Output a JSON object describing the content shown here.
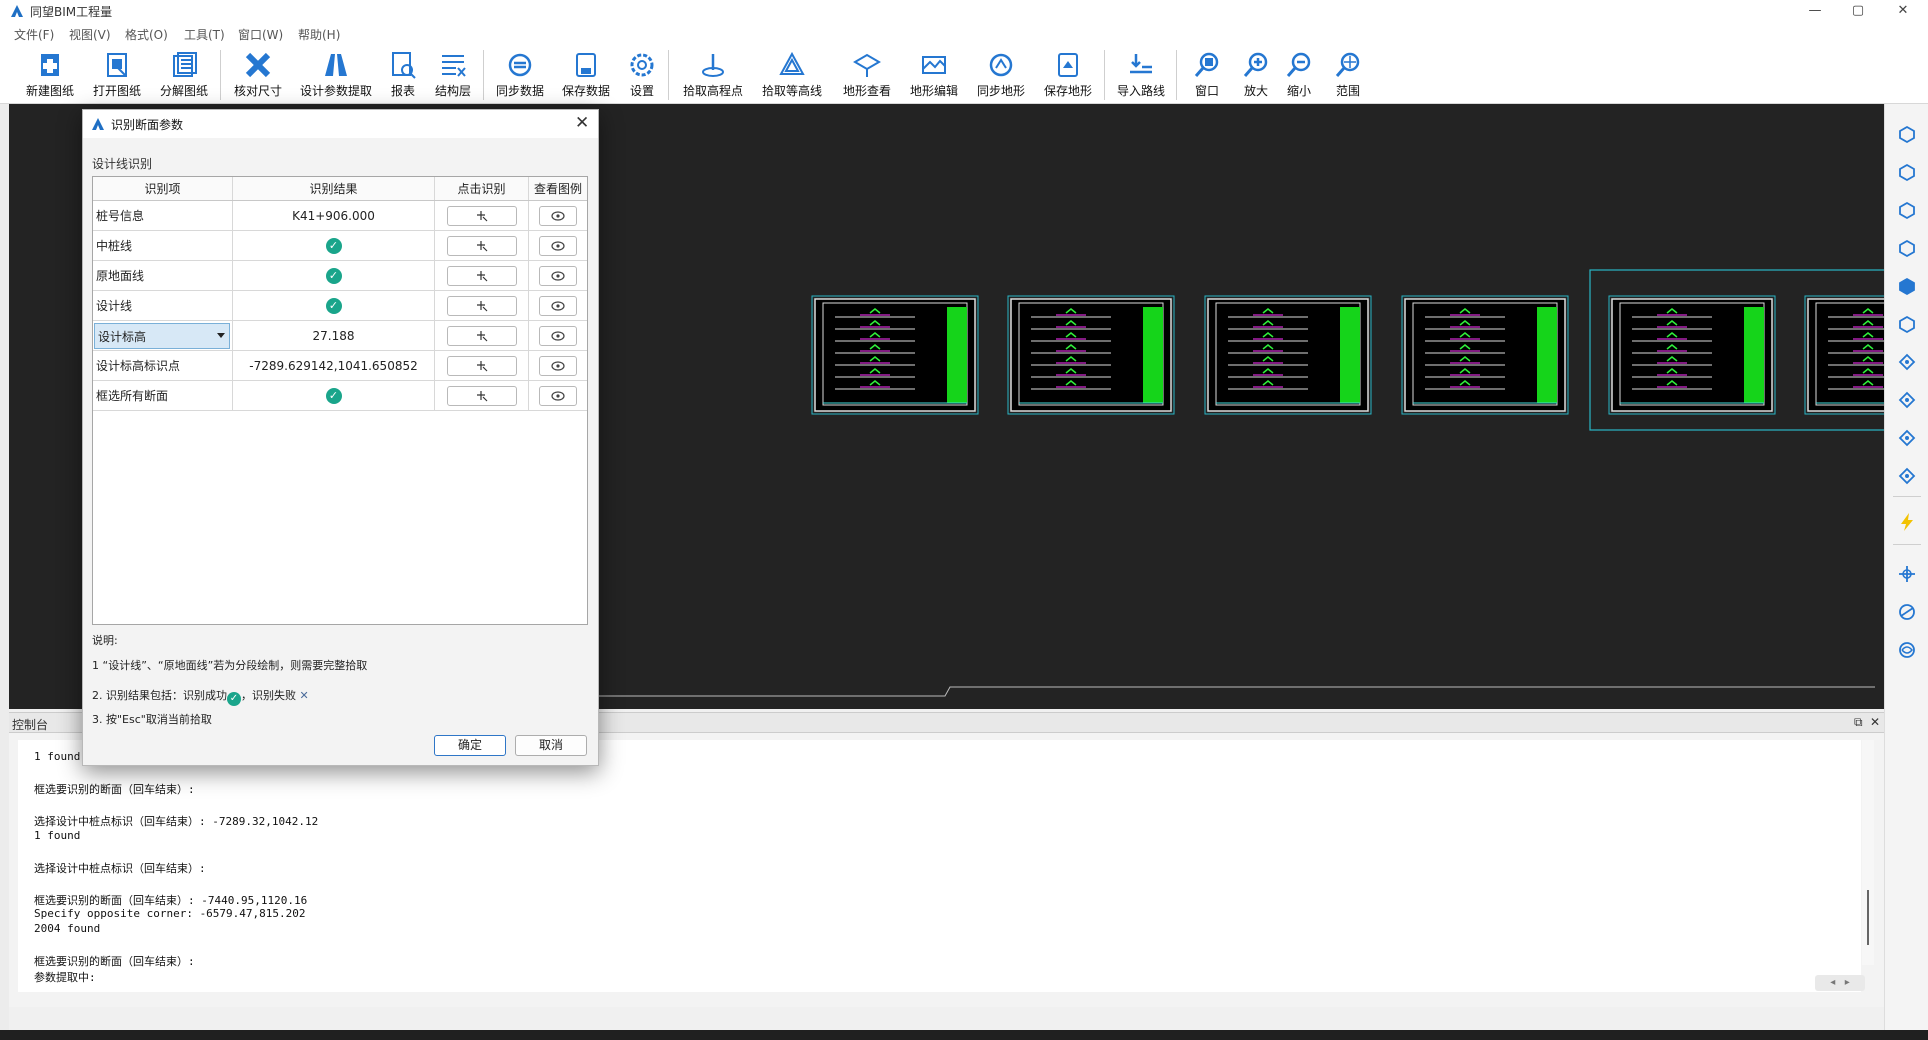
{
  "app": {
    "title": "同望BIM工程量",
    "window_controls": [
      "—",
      "▢",
      "✕"
    ]
  },
  "menu": [
    "文件(F)",
    "视图(V)",
    "格式(O)",
    "工具(T)",
    "窗口(W)",
    "帮助(H)"
  ],
  "toolbar": {
    "new": "新建图纸",
    "open": "打开图纸",
    "split": "分解图纸",
    "check": "核对尺寸",
    "extract": "设计参数提取",
    "report": "报表",
    "layer": "结构层",
    "sync": "同步数据",
    "save": "保存数据",
    "settings": "设置",
    "pick_point": "拾取高程点",
    "pick_contour": "拾取等高线",
    "terrain_view": "地形查看",
    "terrain_edit": "地形编辑",
    "terrain_sync": "同步地形",
    "terrain_save": "保存地形",
    "import_route": "导入路线",
    "window": "窗口",
    "zoom_in": "放大",
    "zoom_out": "缩小",
    "extent": "范围"
  },
  "dialog": {
    "title": "识别断面参数",
    "group_label": "设计线识别",
    "columns": [
      "识别项",
      "识别结果",
      "点击识别",
      "查看图例"
    ],
    "rows": [
      {
        "item": "桩号信息",
        "result": "K41+906.000",
        "status": "text"
      },
      {
        "item": "中桩线",
        "result": "",
        "status": "success"
      },
      {
        "item": "原地面线",
        "result": "",
        "status": "success"
      },
      {
        "item": "设计线",
        "result": "",
        "status": "success"
      },
      {
        "item": "设计标高",
        "result": "27.188",
        "status": "text"
      },
      {
        "item": "设计标高标识点",
        "result": "-7289.629142,1041.650852",
        "status": "text"
      },
      {
        "item": "框选所有断面",
        "result": "",
        "status": "success"
      }
    ],
    "notes_title": "说明:",
    "note1": "1 “设计线”、“原地面线”若为分段绘制，则需要完整拾取",
    "note2_prefix": "2. 识别结果包括：识别成功",
    "note2_mid": "，识别失败",
    "note3": "3. 按\"Esc\"取消当前拾取",
    "ok": "确定",
    "cancel": "取消"
  },
  "console": {
    "title": "控制台",
    "lines": [
      "1 found",
      "",
      "框选要识别的断面（回车结束）:",
      "",
      "选择设计中桩点标识（回车结束）: -7289.32,1042.12",
      "1 found",
      "",
      "选择设计中桩点标识（回车结束）:",
      "",
      "框选要识别的断面（回车结束）: -7440.95,1120.16",
      "Specify opposite corner: -6579.47,815.202",
      "2004 found",
      "",
      "框选要识别的断面（回车结束）:",
      "参数提取中:"
    ]
  }
}
